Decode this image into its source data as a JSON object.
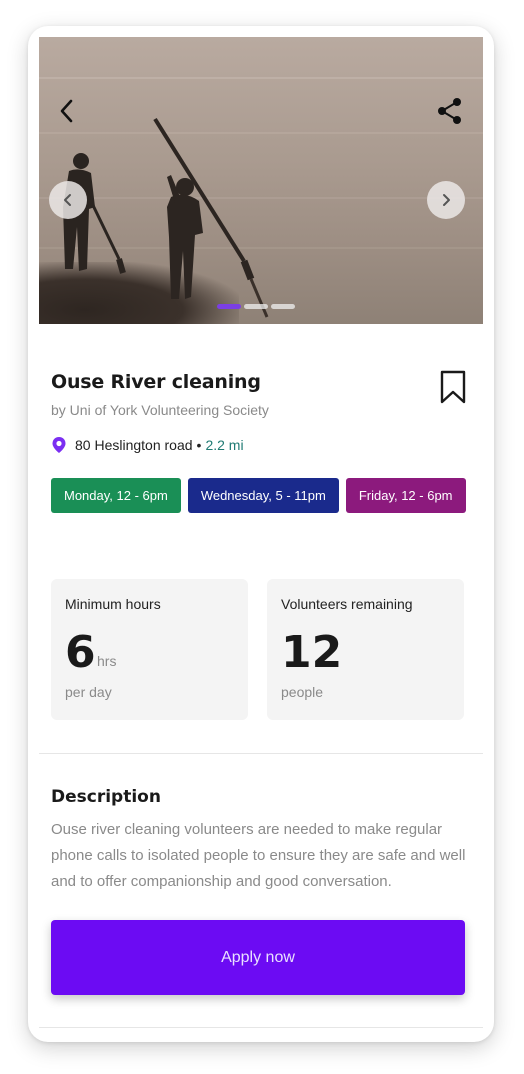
{
  "hero": {
    "back_icon": "chevron-left-icon",
    "share_icon": "share-icon",
    "prev_icon": "chevron-left-icon",
    "next_icon": "chevron-right-icon",
    "image_alt": "People cleaning a river with long poles",
    "slide_count": 3,
    "active_slide": 1
  },
  "event": {
    "title": "Ouse River cleaning",
    "organizer": "by Uni of York Volunteering Society",
    "bookmark_icon": "bookmark-icon",
    "location_icon": "map-pin-icon",
    "address": "80 Heslington road",
    "separator": "•",
    "distance": "2.2 mi"
  },
  "schedule": [
    {
      "label": "Monday, 12 - 6pm",
      "color": "#1a8f56"
    },
    {
      "label": "Wednesday, 5 - 11pm",
      "color": "#1a2a8c"
    },
    {
      "label": "Friday, 12 - 6pm",
      "color": "#8c1a7d"
    }
  ],
  "stats": {
    "min_hours": {
      "label": "Minimum hours",
      "value": "6",
      "unit": "hrs",
      "sub": "per day"
    },
    "volunteers": {
      "label": "Volunteers remaining",
      "value": "12",
      "sub": "people"
    }
  },
  "description": {
    "heading": "Description",
    "text": "Ouse river cleaning volunteers are needed to make regular phone calls to isolated people to ensure they are safe and well and to offer companionship and good conversation."
  },
  "actions": {
    "apply_label": "Apply now",
    "accent": "#6c0bf3"
  }
}
